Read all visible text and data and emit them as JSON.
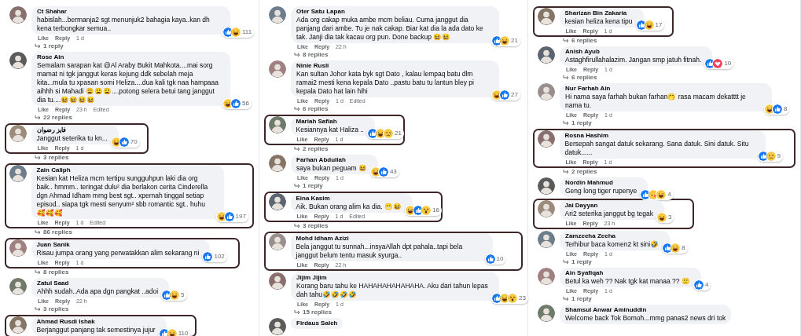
{
  "columns": [
    {
      "comments": [
        {
          "name": "Ct Shahar",
          "text": "habislah...bermanja2 sgt menunjuk2 bahagia kaya..kan dh kena terbongkar semua..",
          "reactions": [
            {
              "kind": "like"
            },
            {
              "kind": "haha"
            }
          ],
          "count": "111",
          "actions": [
            "Like",
            "Reply"
          ],
          "time": "1 d",
          "replies": "1 reply",
          "highlighted": false
        },
        {
          "name": "Rose Ain",
          "text": "Semalam sarapan kat @Al Araby Bukit Mahkota....mai sorg mamat ni tgk janggut keras kejung ddk sebelah meja kita...mula tu xpasan somi Heliza....dua kali tgk naa hampaaa aihhh si Mahadi 😩😩😩....potong selera betui tang janggut dia tu....😆😆😆😆",
          "reactions": [
            {
              "kind": "haha"
            },
            {
              "kind": "like"
            }
          ],
          "count": "56",
          "actions": [
            "Like",
            "Reply"
          ],
          "time": "23 h",
          "edited": "Edited",
          "replies": "22 replies",
          "highlighted": false
        },
        {
          "name": "فايز رضوان",
          "text": "Janggut seterika tu kn...",
          "reactions": [
            {
              "kind": "haha"
            },
            {
              "kind": "like"
            }
          ],
          "count": "70",
          "actions": [
            "Like",
            "Reply"
          ],
          "time": "1 d",
          "replies": "3 replies",
          "highlighted": true
        },
        {
          "name": "Zain Caliph",
          "text": "Kesian kat Heliza mcm tertipu sungguhpun laki dia org baik.. hmmm.. teringat dulu² dia berlakon cerita Cinderella dgn Ahmad Idham mmg best sgt.. xpernah tinggal setiap episod.. siapa tgk mesti senyum² sbb romantic sgt.. huhu 🥰🥰🥰",
          "reactions": [
            {
              "kind": "haha"
            },
            {
              "kind": "like"
            }
          ],
          "count": "197",
          "actions": [
            "Like",
            "Reply"
          ],
          "time": "1 d",
          "edited": "Edited",
          "replies": "86 replies",
          "highlighted": true
        },
        {
          "name": "Juan Sanik",
          "text": "Risau jumpa orang yang perwatakkan alim sekarang ni",
          "reactions": [
            {
              "kind": "like"
            }
          ],
          "count": "102",
          "actions": [
            "Like",
            "Reply"
          ],
          "time": "1 d",
          "replies": "8 replies",
          "highlighted": true
        },
        {
          "name": "Zatul Saad",
          "text": "Ahhh sudah..Ada apa dgn pangkat ..adoi",
          "reactions": [
            {
              "kind": "like"
            },
            {
              "kind": "haha"
            }
          ],
          "count": "5",
          "actions": [
            "Like",
            "Reply"
          ],
          "time": "22 h",
          "replies": "3 replies",
          "highlighted": false
        },
        {
          "name": "Ahmad Rusdi Ishak",
          "text": "Berjanggut panjang tak semestinya jujur",
          "reactions": [
            {
              "kind": "like"
            },
            {
              "kind": "haha"
            }
          ],
          "count": "110",
          "highlighted": true
        }
      ]
    },
    {
      "comments": [
        {
          "name": "Oter Satu Lapan",
          "text": "Ada org cakap muka ambe mcm beliau. Cuma janggut dia panjang dari ambe. Tu je nak cakap. Biar kat dia la ada dato ke tak. Janji dia tak kacau org pun. Done backup 😆😆",
          "reactions": [
            {
              "kind": "like"
            },
            {
              "kind": "haha"
            }
          ],
          "count": "21",
          "actions": [
            "Like",
            "Reply"
          ],
          "time": "22 h",
          "replies": "8 replies",
          "highlighted": false
        },
        {
          "name": "Ninie Rusli",
          "text": "Kan sultan Johor kata byk sgt Dato , kalau lempaq batu dlm ramai2 mesti kena kepala Dato ..pastu batu tu lantun bley pi kepala Dato hat lain hihi",
          "reactions": [
            {
              "kind": "haha"
            },
            {
              "kind": "like"
            }
          ],
          "count": "27",
          "actions": [
            "Like",
            "Reply"
          ],
          "time": "1 d",
          "edited": "Edited",
          "replies": "6 replies",
          "highlighted": false
        },
        {
          "name": "Mariah Safiah",
          "text": "Kesiannya kat Haliza ..",
          "reactions": [
            {
              "kind": "like"
            },
            {
              "kind": "haha"
            },
            {
              "kind": "sad"
            }
          ],
          "count": "21",
          "actions": [
            "Like",
            "Reply"
          ],
          "time": "1 d",
          "replies": "2 replies",
          "highlighted": true
        },
        {
          "name": "Farhan Abdullah",
          "text": "saya bukan peguam 😆",
          "reactions": [
            {
              "kind": "haha"
            },
            {
              "kind": "like"
            }
          ],
          "count": "43",
          "actions": [
            "Like",
            "Reply"
          ],
          "time": "1 d",
          "replies": "1 reply",
          "highlighted": false
        },
        {
          "name": "Eina Kasim",
          "text": "Aik. Bukan orang alim ka dia. 😬😆",
          "reactions": [
            {
              "kind": "haha"
            },
            {
              "kind": "like"
            },
            {
              "kind": "wow"
            }
          ],
          "count": "16",
          "actions": [
            "Like",
            "Reply"
          ],
          "time": "1 d",
          "edited": "Edited",
          "replies": "3 replies",
          "highlighted": true
        },
        {
          "name": "Mohd Idham Azizi",
          "text": "Bela janggut tu sunnah...insyaAllah dpt pahala..tapi bela janggut belum tentu masuk syurga..",
          "reactions": [
            {
              "kind": "like"
            }
          ],
          "count": "10",
          "actions": [
            "Like",
            "Reply"
          ],
          "time": "22 h",
          "highlighted": true
        },
        {
          "name": "Jijim Jijim",
          "text": "Korang baru tahu ke HAHAHAHAHAHAHA. Aku dari tahun lepas dah tahu🤣🤣🤣🤣",
          "reactions": [
            {
              "kind": "like"
            },
            {
              "kind": "haha"
            },
            {
              "kind": "wow"
            }
          ],
          "count": "23",
          "actions": [
            "Like",
            "Reply"
          ],
          "time": "1 d",
          "replies": "15 replies",
          "highlighted": false
        },
        {
          "name": "Firdaus Saleh",
          "highlighted": false
        }
      ]
    },
    {
      "comments": [
        {
          "name": "Sharizan Bin Zakaria",
          "text": "kesian heliza kena tipu",
          "reactions": [
            {
              "kind": "like"
            },
            {
              "kind": "haha"
            }
          ],
          "count": "17",
          "actions": [
            "Like",
            "Reply"
          ],
          "time": "1 d",
          "replies": "6 replies",
          "highlighted": true
        },
        {
          "name": "Anish Ayub",
          "text": "Astaghfirullahalazim. Jangan smp jatuh fitnah.",
          "reactions": [
            {
              "kind": "like"
            },
            {
              "kind": "love"
            }
          ],
          "count": "10",
          "actions": [
            "Like",
            "Reply"
          ],
          "time": "1 d",
          "replies": "6 replies",
          "highlighted": false
        },
        {
          "name": "Nur Farhah Ain",
          "text": "Hi nama saya farhah bukan farhan🤭 rasa macam dekatttt je nama tu.",
          "reactions": [
            {
              "kind": "haha"
            },
            {
              "kind": "like"
            }
          ],
          "count": "8",
          "actions": [
            "Like",
            "Reply"
          ],
          "time": "1 d",
          "replies": "1 reply",
          "highlighted": false
        },
        {
          "name": "Rosna Hashim",
          "text": "Bersepah sangat datuk sekarang. Sana datuk. Sini datuk. Situ datuk......",
          "reactions": [
            {
              "kind": "like"
            },
            {
              "kind": "sad"
            }
          ],
          "count": "9",
          "actions": [
            "Like",
            "Reply"
          ],
          "time": "1 d",
          "replies": "2 replies",
          "highlighted": true
        },
        {
          "name": "Nordin Mahmud",
          "text": "Geng long tiger rupenye",
          "reactions": [
            {
              "kind": "like"
            },
            {
              "kind": "care"
            },
            {
              "kind": "haha"
            }
          ],
          "count": "4",
          "highlighted": false
        },
        {
          "name": "Jai Dayyan",
          "text": "Ari2 seterika janggut bg tegak",
          "reactions": [
            {
              "kind": "haha"
            }
          ],
          "count": "3",
          "actions": [
            "Like",
            "Reply"
          ],
          "time": "23 h",
          "highlighted": true
        },
        {
          "name": "Zamzeeha Zeeha",
          "text": "Terhibur baca komen2 kt sini🤣",
          "reactions": [
            {
              "kind": "like"
            },
            {
              "kind": "haha"
            }
          ],
          "count": "8",
          "actions": [
            "Like",
            "Reply"
          ],
          "time": "1 d",
          "replies": "1 reply",
          "highlighted": false
        },
        {
          "name": "Ain Syafiqah",
          "text": "Betul ka weh ?? Nak tgk kat manaa ?? 😕",
          "reactions": [
            {
              "kind": "like"
            }
          ],
          "count": "4",
          "actions": [
            "Like",
            "Reply"
          ],
          "time": "1 d",
          "replies": "1 reply",
          "highlighted": false
        },
        {
          "name": "Shamsul Anwar Aminuddin",
          "text": "Welcome back Tok Bomoh...mmg panas2 news dri tok",
          "highlighted": false
        }
      ]
    }
  ]
}
